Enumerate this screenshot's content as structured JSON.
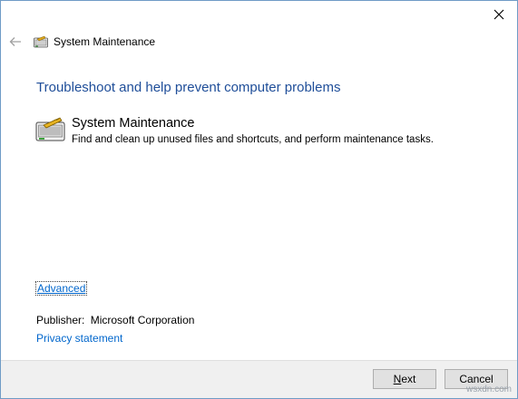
{
  "window": {
    "title": "System Maintenance",
    "close_icon": "close-icon",
    "back_icon": "back-arrow-icon"
  },
  "main": {
    "heading": "Troubleshoot and help prevent computer problems",
    "task": {
      "title": "System Maintenance",
      "description": "Find and clean up unused files and shortcuts, and perform maintenance tasks.",
      "icon": "system-maintenance-icon"
    },
    "advanced_link": "Advanced",
    "publisher_label": "Publisher:",
    "publisher_value": "Microsoft Corporation",
    "privacy_link": "Privacy statement"
  },
  "footer": {
    "next_label_mnemonic": "N",
    "next_label_rest": "ext",
    "cancel_label": "Cancel"
  },
  "watermark": "wsxdn.com",
  "colors": {
    "heading": "#1f4e99",
    "link": "#0066cc",
    "footer_bg": "#f0f0f0",
    "frame_border": "#6f9bc6"
  }
}
